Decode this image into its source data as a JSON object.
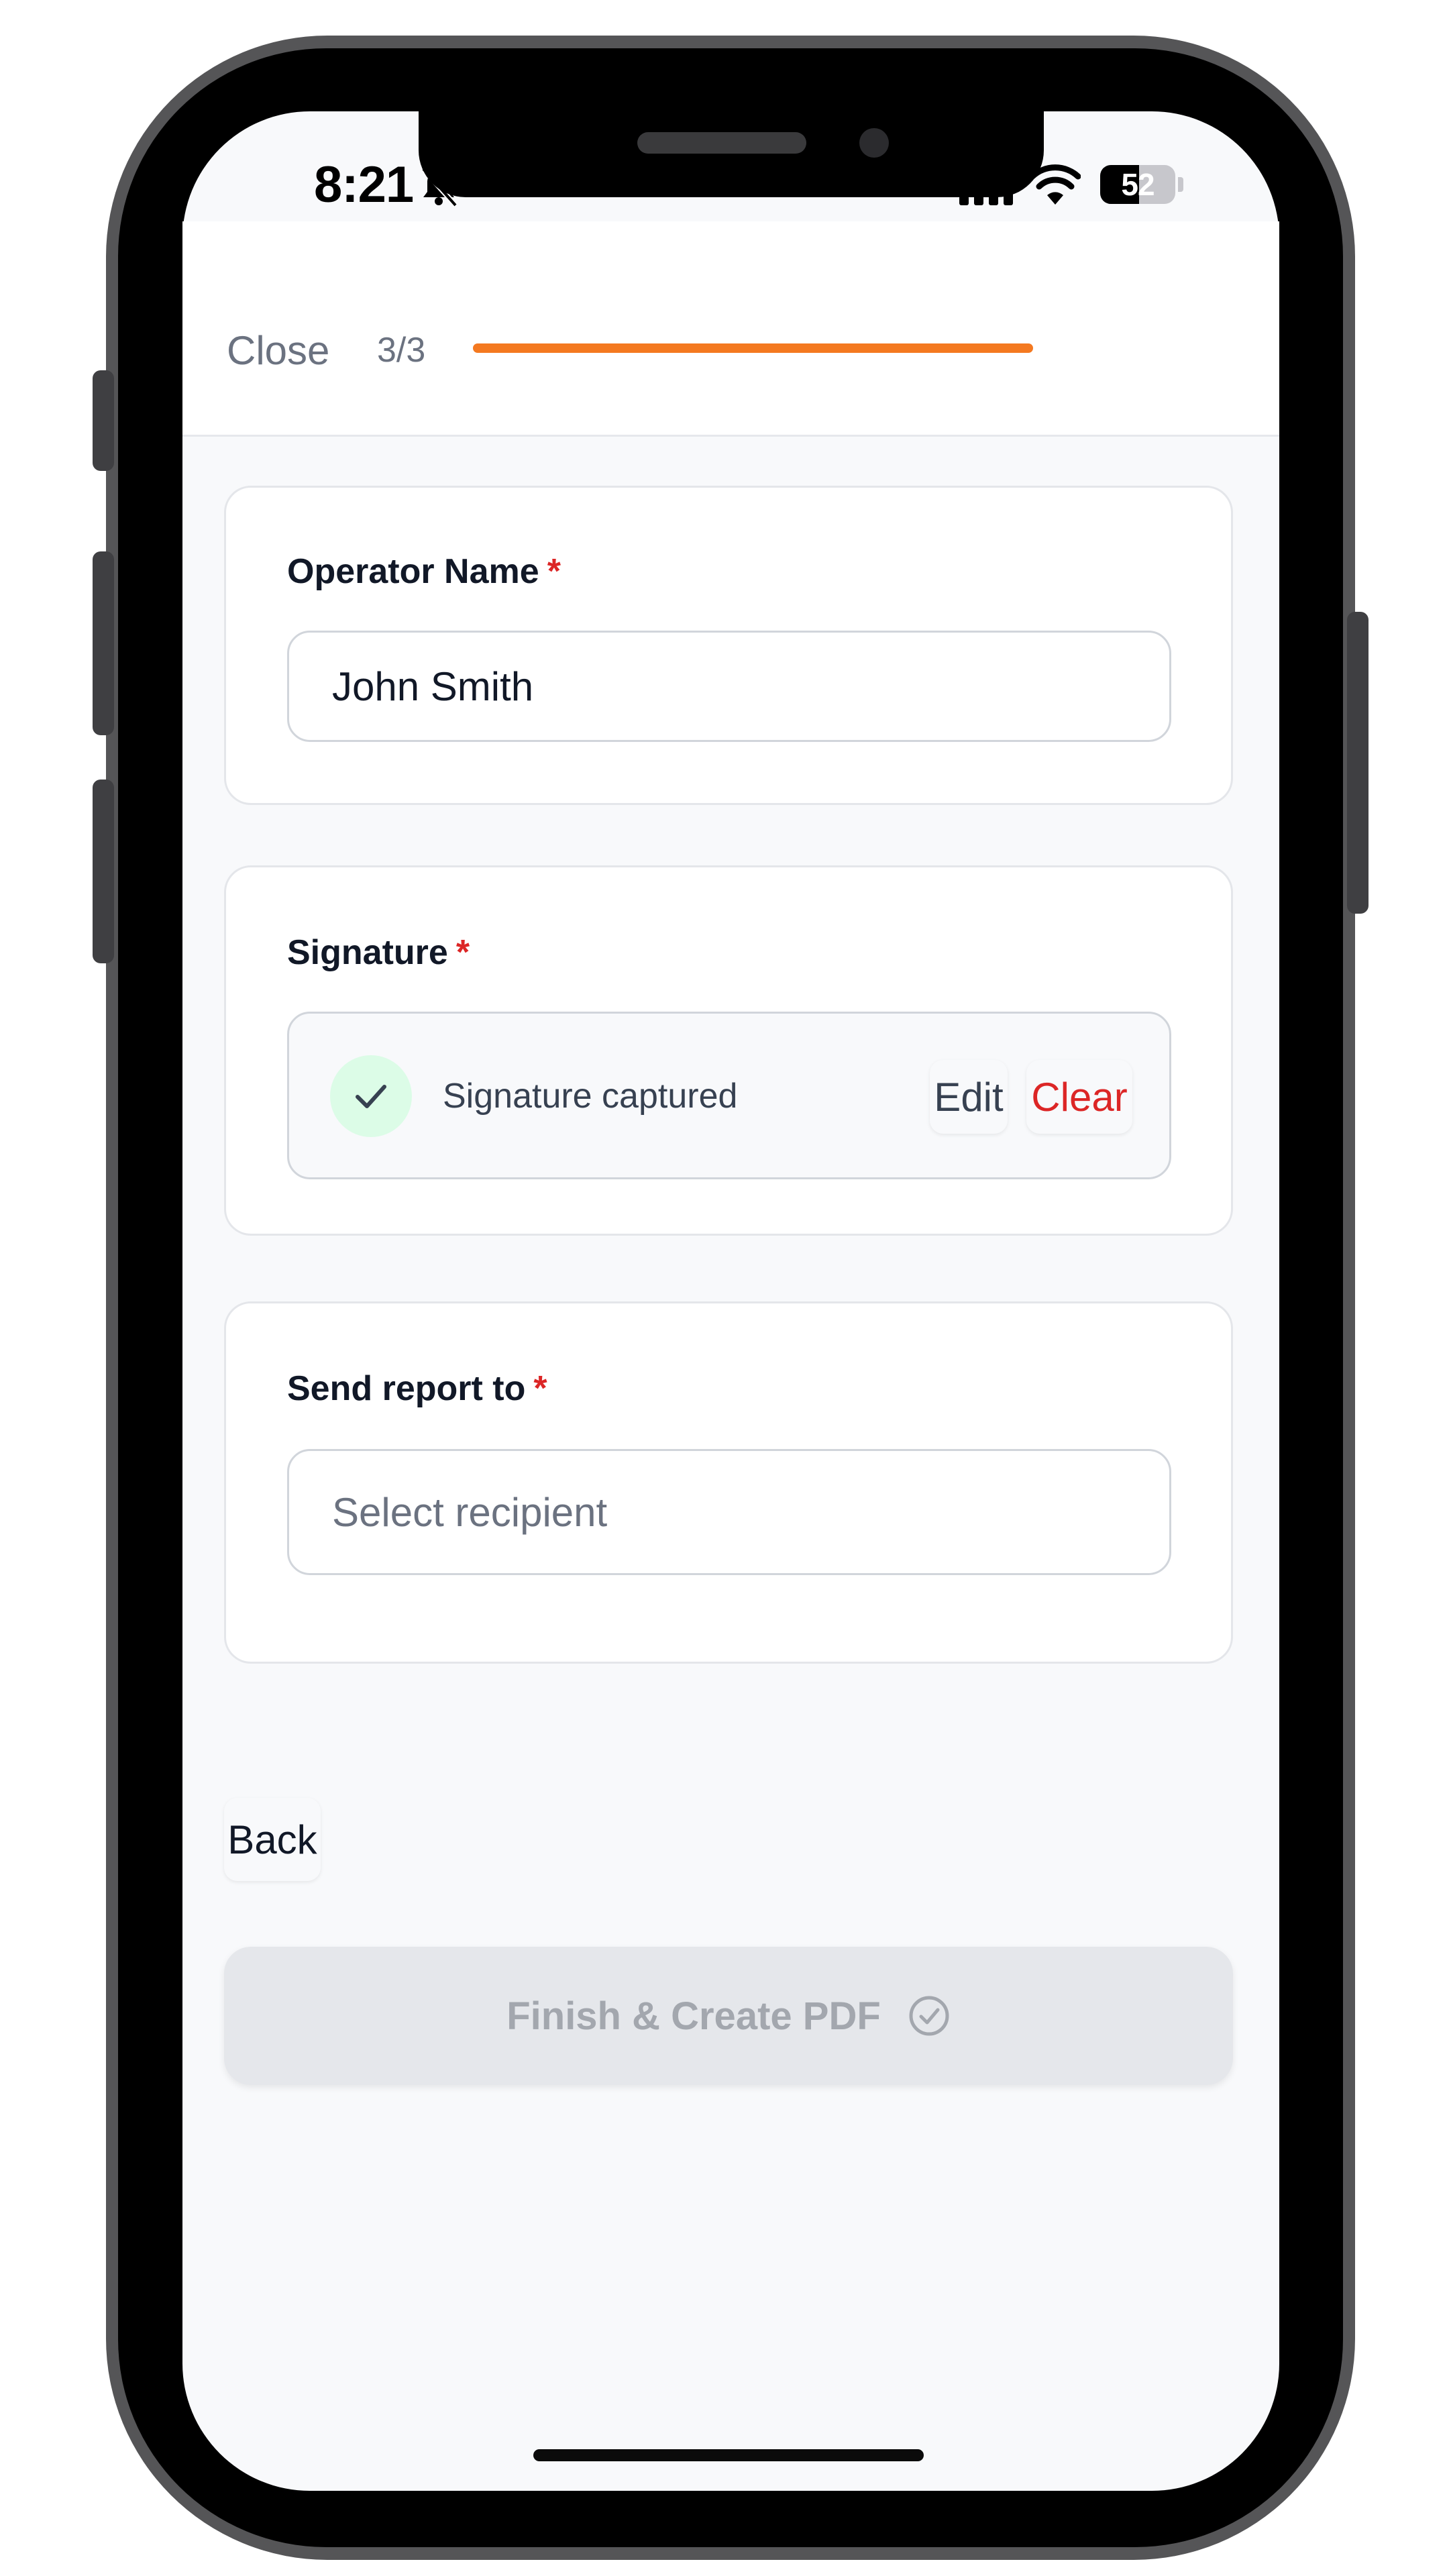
{
  "status_bar": {
    "time": "8:21",
    "battery_percent": "52",
    "battery_level": 0.52,
    "icons": [
      "bell-slash-icon",
      "signal-icon",
      "wifi-icon",
      "battery-icon"
    ]
  },
  "header": {
    "close_label": "Close",
    "step": "3/3",
    "progress": 1.0,
    "progress_color": "#f47920"
  },
  "form": {
    "operator": {
      "label": "Operator Name",
      "required_mark": "*",
      "value": "John Smith"
    },
    "signature": {
      "label": "Signature",
      "required_mark": "*",
      "status": "Signature captured",
      "edit_label": "Edit",
      "clear_label": "Clear"
    },
    "recipient": {
      "label": "Send report to",
      "required_mark": "*",
      "placeholder": "Select recipient"
    }
  },
  "actions": {
    "back_label": "Back",
    "finish_label": "Finish & Create PDF",
    "finish_enabled": false
  },
  "colors": {
    "accent": "#f47920",
    "required": "#dc2626",
    "success_bg": "#dcfce7"
  }
}
